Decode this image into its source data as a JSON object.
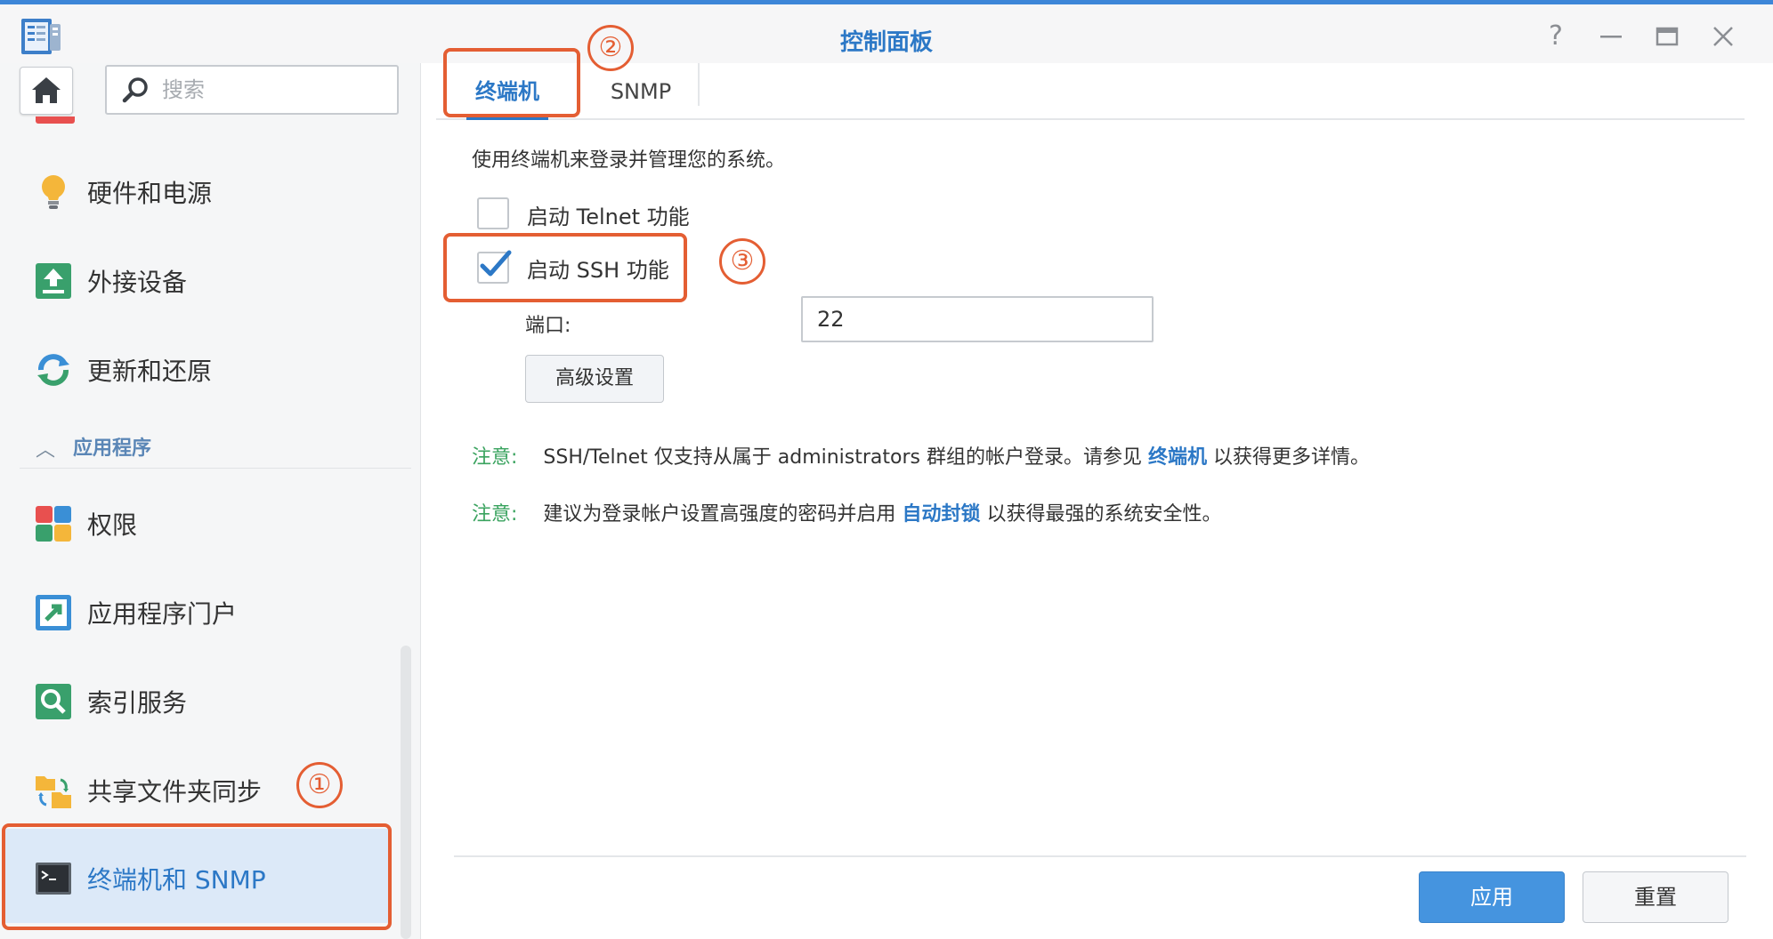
{
  "window": {
    "title": "控制面板"
  },
  "sidebar": {
    "search_placeholder": "搜索",
    "items": [
      {
        "label": "硬件和电源",
        "icon": "lightbulb-icon"
      },
      {
        "label": "外接设备",
        "icon": "external-device-icon"
      },
      {
        "label": "更新和还原",
        "icon": "update-restore-icon"
      },
      {
        "label": "权限",
        "icon": "privileges-icon"
      },
      {
        "label": "应用程序门户",
        "icon": "app-portal-icon"
      },
      {
        "label": "索引服务",
        "icon": "indexing-service-icon"
      },
      {
        "label": "共享文件夹同步",
        "icon": "shared-folder-sync-icon"
      },
      {
        "label": "终端机和 SNMP",
        "icon": "terminal-icon"
      }
    ],
    "group_header": "应用程序",
    "selected": "终端机和 SNMP"
  },
  "tabs": [
    {
      "label": "终端机",
      "active": true
    },
    {
      "label": "SNMP",
      "active": false
    }
  ],
  "terminal": {
    "description": "使用终端机来登录并管理您的系统。",
    "telnet_label": "启动 Telnet 功能",
    "telnet_checked": false,
    "ssh_label": "启动 SSH 功能",
    "ssh_checked": true,
    "port_label": "端口:",
    "port_value": "22",
    "advanced_button": "高级设置",
    "notes": [
      {
        "prefix": "注意:",
        "text_before": "SSH/Telnet 仅支持从属于 administrators 群组的帐户登录。请参见",
        "link": "终端机",
        "text_after": "以获得更多详情。"
      },
      {
        "prefix": "注意:",
        "text_before": "建议为登录帐户设置高强度的密码并启用",
        "link": "自动封锁",
        "text_after": "以获得最强的系统安全性。"
      }
    ]
  },
  "footer": {
    "apply": "应用",
    "reset": "重置"
  },
  "annotations": [
    "①",
    "②",
    "③"
  ],
  "colors": {
    "accent": "#2c78c6",
    "annotation": "#e45e33",
    "note": "#3aa35f",
    "apply_button": "#4594df"
  }
}
